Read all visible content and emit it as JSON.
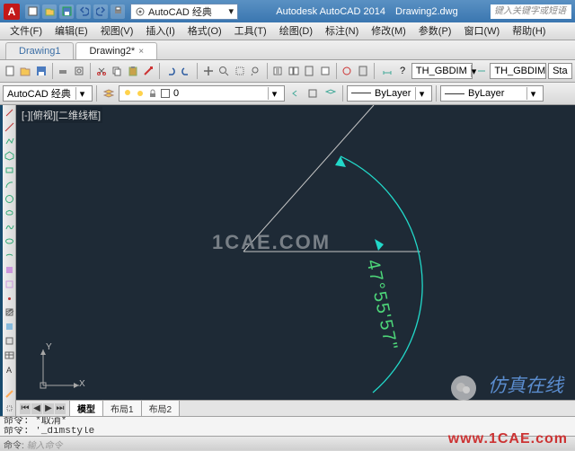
{
  "titlebar": {
    "app_letter": "A",
    "workspace": "AutoCAD 经典",
    "app_name": "Autodesk AutoCAD 2014",
    "file_name": "Drawing2.dwg",
    "search_placeholder": "键入关键字或短语"
  },
  "menu": {
    "items": [
      "文件(F)",
      "编辑(E)",
      "视图(V)",
      "插入(I)",
      "格式(O)",
      "工具(T)",
      "绘图(D)",
      "标注(N)",
      "修改(M)",
      "参数(P)",
      "窗口(W)",
      "帮助(H)"
    ]
  },
  "file_tabs": {
    "items": [
      {
        "label": "Drawing1",
        "active": false
      },
      {
        "label": "Drawing2*",
        "active": true
      }
    ]
  },
  "toolbars": {
    "row2": {
      "layer": {
        "color": "#ffffff",
        "name": "AutoCAD 经典"
      },
      "dim_style_1": "TH_GBDIM",
      "dim_style_2": "TH_GBDIM",
      "annotative": "Sta"
    },
    "row3": {
      "layer_name": "0",
      "linetype": "ByLayer",
      "lineweight": "ByLayer"
    }
  },
  "viewport": {
    "label": "[-][俯视][二维线框]",
    "dimension": "47°55'57\"",
    "watermark": "1CAE.COM",
    "ucs_x": "X",
    "ucs_y": "Y"
  },
  "layout_tabs": {
    "items": [
      "模型",
      "布局1",
      "布局2"
    ],
    "active": 0
  },
  "command": {
    "line1": "命令: *取消*",
    "line2_prompt": "命令:",
    "line2_value": "'_dimstyle",
    "bottom_prompt": "命令:",
    "bottom_value": "输入命令"
  },
  "credits": {
    "wechat": "仿真在线",
    "url": "www.1CAE.com"
  }
}
